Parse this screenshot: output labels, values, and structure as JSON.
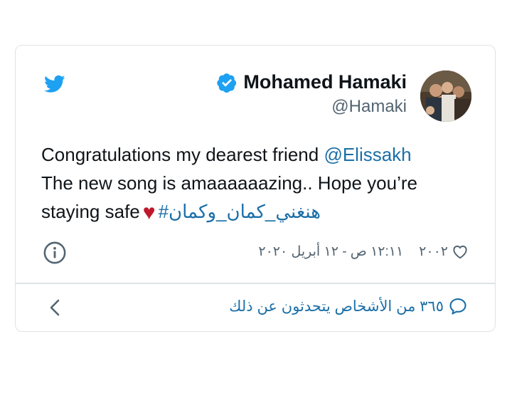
{
  "tweet": {
    "author_name": "Mohamed Hamaki",
    "handle": "@Hamaki",
    "text_line1": "Congratulations my dearest friend ",
    "mention": "@Elissakh",
    "text_line2": " The new song is amaaaaaazing.. Hope you’re",
    "text_line3": "staying safe",
    "heart_emoji": "♥",
    "hashtag": "#هنغني_كمان_وكمان",
    "timestamp": "١٢:١١ ص - ١٢ أبريل ٢٠٢٠",
    "like_count": "٢٠٠٢",
    "replies_text": "٣٦٥ من الأشخاص يتحدثون عن ذلك"
  },
  "colors": {
    "brand": "#1da1f2",
    "link": "#1b6fa8",
    "muted": "#536471",
    "heart": "#c1172c",
    "border": "#dfe3e6"
  },
  "icons": {
    "logo": "twitter-bird-icon",
    "verified": "verified-badge-icon",
    "info": "info-icon",
    "like": "heart-outline-icon",
    "reply": "speech-bubble-icon",
    "chevron": "chevron-left-icon"
  }
}
